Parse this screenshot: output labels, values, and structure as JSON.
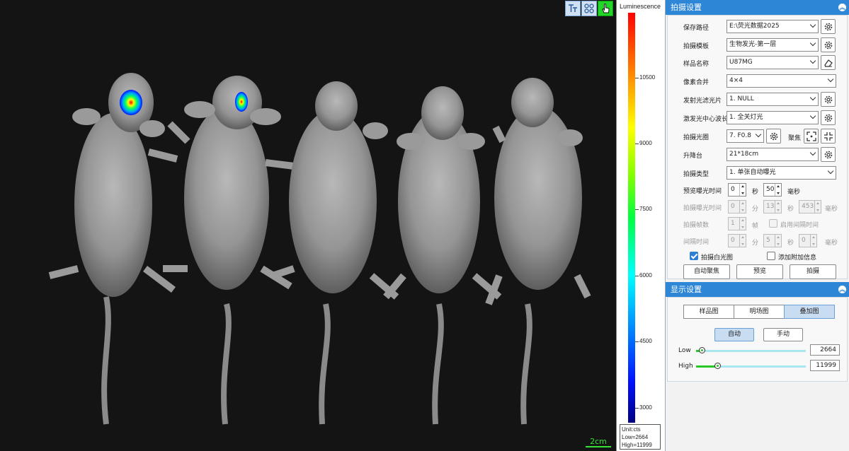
{
  "viewer": {
    "scale_label": "2cm",
    "tools": [
      {
        "icon": "text-tool-icon",
        "active": false
      },
      {
        "icon": "roi-tool-icon",
        "active": false
      },
      {
        "icon": "hand-pointer-icon",
        "active": true
      }
    ]
  },
  "legend": {
    "title": "Luminescence",
    "ticks": [
      "10500",
      "9000",
      "7500",
      "6000",
      "4500",
      "3000"
    ],
    "unit_line": "Unit:cts",
    "low_line": "Low=2664",
    "high_line": "High=11999"
  },
  "capture": {
    "header": "拍摄设置",
    "save_path_label": "保存路径",
    "save_path_value": "E:\\荧光数据2025",
    "template_label": "拍摄模板",
    "template_value": "生物发光-第一层",
    "sample_label": "样品名称",
    "sample_value": "U87MG",
    "binning_label": "像素合并",
    "binning_value": "4×4",
    "emission_label": "发射光滤光片",
    "emission_value": "1. NULL",
    "excitation_label": "激发光中心波长",
    "excitation_value": "1. 全关灯光",
    "aperture_label": "拍摄光圈",
    "aperture_value": "7. F0.8",
    "focus_label": "聚焦",
    "stage_label": "升降台",
    "stage_value": "21*18cm",
    "type_label": "拍摄类型",
    "type_value": "1. 单张自动曝光",
    "preview_exp_label": "预览曝光时间",
    "preview_exp_sec": "0",
    "preview_exp_sec_unit": "秒",
    "preview_exp_ms": "50",
    "preview_exp_ms_unit": "毫秒",
    "capture_exp_label": "拍摄曝光时间",
    "capture_exp_min": "0",
    "capture_exp_min_unit": "分",
    "capture_exp_sec": "13",
    "capture_exp_sec_unit": "秒",
    "capture_exp_ms": "453",
    "capture_exp_ms_unit": "毫秒",
    "frames_label": "拍摄帧数",
    "frames_value": "1",
    "frames_unit": "帧",
    "enable_interval_label": "启用间隔时间",
    "interval_label": "间隔时间",
    "interval_min": "0",
    "interval_min_unit": "分",
    "interval_sec": "5",
    "interval_sec_unit": "秒",
    "interval_ms": "0",
    "interval_ms_unit": "毫秒",
    "white_light_label": "拍摄白光图",
    "extra_info_label": "添加附加信息",
    "autofocus_label": "自动聚焦",
    "preview_label": "预览",
    "shoot_label": "拍摄"
  },
  "display": {
    "header": "显示设置",
    "tabs": [
      "样品图",
      "明场图",
      "叠加图"
    ],
    "selected_tab": "叠加图",
    "auto_label": "自动",
    "manual_label": "手动",
    "low_label": "Low",
    "low_value": "2664",
    "high_label": "High",
    "high_value": "11999"
  },
  "colors": {
    "accent": "#2e86d6",
    "active_tool": "#21d626",
    "scale_green": "#35e335"
  }
}
